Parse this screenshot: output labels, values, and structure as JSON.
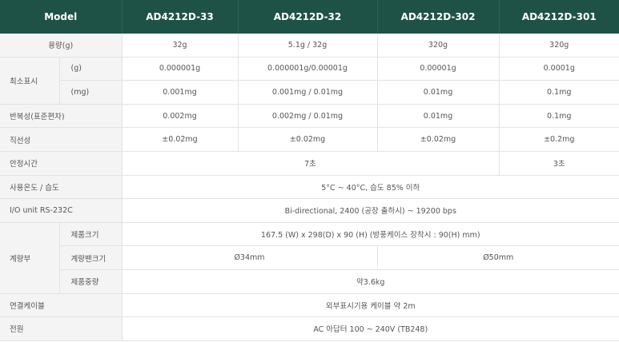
{
  "header": {
    "model": "Model",
    "col1": "AD4212D-33",
    "col2": "AD4212D-32",
    "col3": "AD4212D-302",
    "col4": "AD4212D-301"
  },
  "rows": {
    "capacity": {
      "label": "용량(g)",
      "v1": "32g",
      "v2": "5.1g / 32g",
      "v3": "320g",
      "v4": "320g"
    },
    "min_display": {
      "label": "최소표시",
      "g": {
        "unit": "(g)",
        "v1": "0.000001g",
        "v2": "0.000001g/0.00001g",
        "v3": "0.00001g",
        "v4": "0.0001g"
      },
      "mg": {
        "unit": "(mg)",
        "v1": "0.001mg",
        "v2": "0.001mg / 0.01mg",
        "v3": "0.01mg",
        "v4": "0.1mg"
      }
    },
    "repeatability": {
      "label": "반복성(표준편차)",
      "v1": "0.002mg",
      "v2": "0.002mg / 0.01mg",
      "v3": "0.01mg",
      "v4": "0.1mg"
    },
    "linearity": {
      "label": "직선성",
      "v1": "±0.02mg",
      "v2": "±0.02mg",
      "v3": "±0.02mg",
      "v4": "±0.2mg"
    },
    "stabilization": {
      "label": "안정시간",
      "v123": "7초",
      "v4": "3초"
    },
    "environment": {
      "label": "사용온도 / 습도",
      "value": "5°C ~ 40°C, 습도 85% 이하"
    },
    "io": {
      "label": "I/O unit RS-232C",
      "value": "Bi-directional, 2400 (공장 출하시) ~ 19200 bps"
    },
    "weighing_unit": {
      "label": "계량부",
      "size": {
        "label": "제품크기",
        "value": "167.5 (W) x 298(D) x 90 (H) (방풍케이스 장착시 : 90(H) mm)"
      },
      "pan": {
        "label": "계량팬크기",
        "v12": "Ø34mm",
        "v34": "Ø50mm"
      },
      "weight": {
        "label": "제품중량",
        "value": "약3.6kg"
      }
    },
    "cable": {
      "label": "연결케이블",
      "value": "외부표시기용 케이블 약 2m"
    },
    "power": {
      "label": "전원",
      "value": "AC 아답터 100 ~ 240V (TB248)"
    }
  },
  "colors": {
    "header_bg": "#1f5246",
    "label_bg": "#f4f4f4",
    "border": "#e3e3e3",
    "text": "#555555"
  }
}
